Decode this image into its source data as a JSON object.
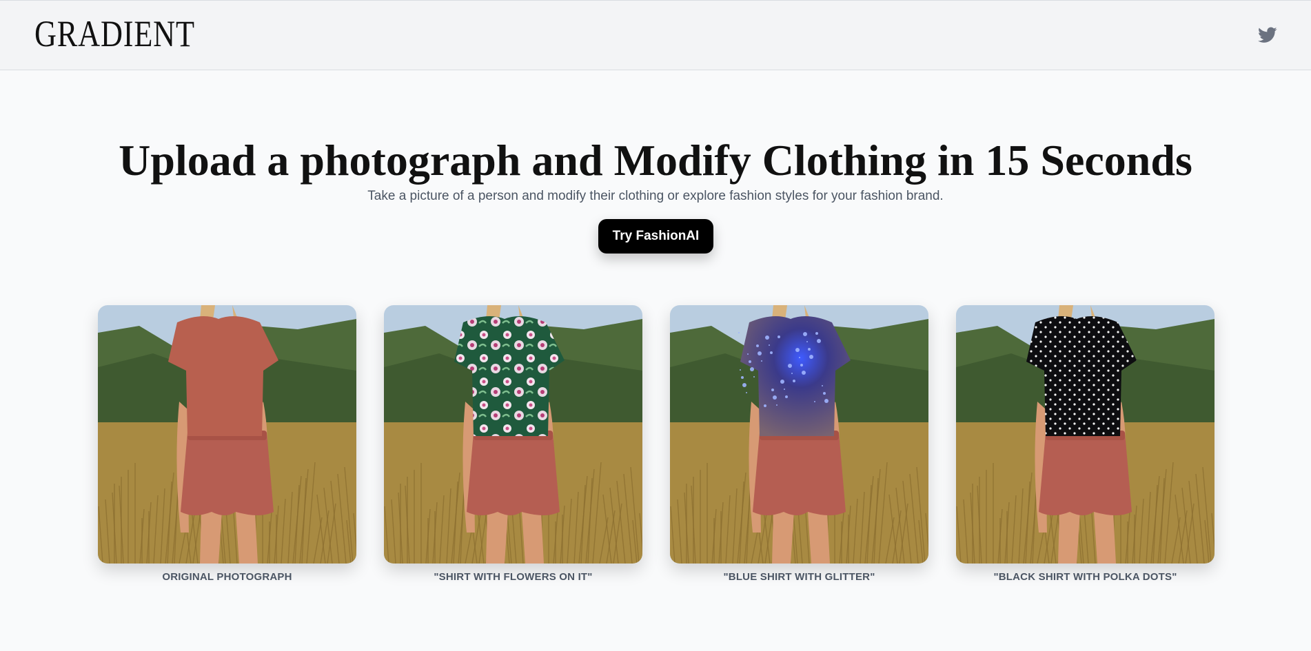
{
  "header": {
    "logo": "GRADIENT",
    "social_icon": "twitter-icon"
  },
  "hero": {
    "title": "Upload a photograph and Modify Clothing in 15 Seconds",
    "subtitle": "Take a picture of a person and modify their clothing or explore fashion styles for your fashion brand.",
    "cta_label": "Try FashionAI"
  },
  "gallery": [
    {
      "caption": "ORIGINAL PHOTOGRAPH",
      "shirt_color": "#b8604f",
      "pattern": "plain"
    },
    {
      "caption": "\"SHIRT WITH FLOWERS ON IT\"",
      "shirt_color": "#1f5a3d",
      "pattern": "flowers"
    },
    {
      "caption": "\"BLUE SHIRT WITH GLITTER\"",
      "shirt_color": "#6a5566",
      "pattern": "glitter"
    },
    {
      "caption": "\"BLACK SHIRT WITH POLKA DOTS\"",
      "shirt_color": "#0d0d10",
      "pattern": "polka-dots"
    }
  ],
  "colors": {
    "page_bg": "#f9fafb",
    "header_bg": "#f3f4f6",
    "cta_bg": "#000000",
    "shorts": "#b55e52",
    "sky": "#b9cde0",
    "hills": "#4e6a3a",
    "grass": "#a88a42",
    "hair": "#d9b27a",
    "skin": "#d79a74",
    "muted_text": "#4b5563"
  }
}
